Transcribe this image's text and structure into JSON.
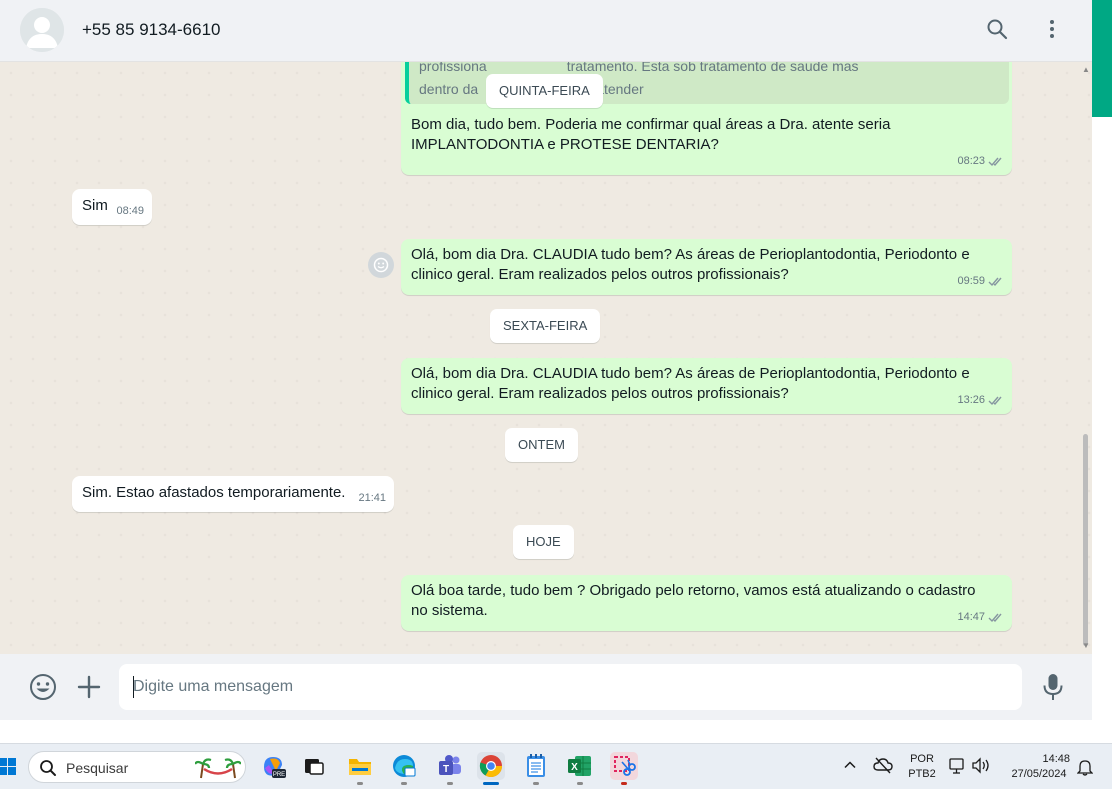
{
  "header": {
    "contact_name": "+55 85 9134-6610"
  },
  "messages": {
    "quote_text": "profissionais de forma ao tratamento. Esta sob tratamento de saude mas dentro da area apta a atender",
    "quote_line1_a": "profissiona",
    "quote_line1_b": "tratamento. Esta sob tratamento de saude mas",
    "quote_line2_a": "dentro da",
    "quote_line2_b": "atender",
    "date_1": "QUINTA-FEIRA",
    "m1_text": "Bom dia, tudo bem. Poderia me confirmar qual áreas a Dra. atente seria IMPLANTODONTIA  e PROTESE DENTARIA?",
    "m1_time": "08:23",
    "m2_text": "Sim",
    "m2_time": "08:49",
    "m3_text": "Olá, bom dia Dra. CLAUDIA tudo bem? As áreas de Perioplantodontia, Periodonto e clinico geral. Eram realizados pelos outros profissionais?",
    "m3_time": "09:59",
    "date_2": "SEXTA-FEIRA",
    "m4_text": "Olá, bom dia Dra. CLAUDIA tudo bem? As áreas de Perioplantodontia, Periodonto e clinico geral. Eram realizados pelos outros profissionais?",
    "m4_time": "13:26",
    "date_3": "ONTEM",
    "m5_text": "Sim. Estao afastados temporariamente.",
    "m5_time": "21:41",
    "date_4": "HOJE",
    "m6_text": "Olá boa tarde, tudo bem ? Obrigado pelo retorno, vamos está atualizando o cadastro no sistema.",
    "m6_time": "14:47"
  },
  "composer": {
    "placeholder": "Digite uma mensagem"
  },
  "taskbar": {
    "search_label": "Pesquisar",
    "lang_top": "POR",
    "lang_bottom": "PTB2",
    "clock_time": "14:48",
    "clock_date": "27/05/2024"
  },
  "colors": {
    "outgoing_bubble": "#d9fdd3",
    "incoming_bubble": "#ffffff",
    "accent": "#00a884",
    "chat_background": "#efeae2"
  }
}
